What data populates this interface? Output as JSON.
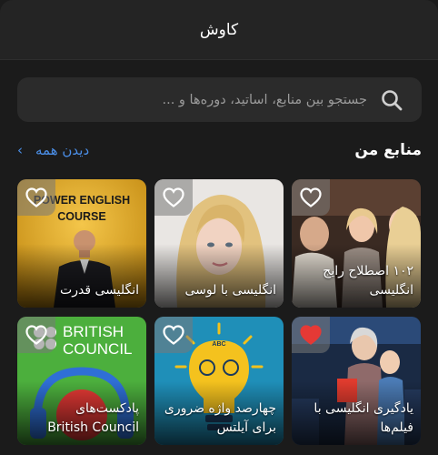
{
  "header": {
    "title": "کاوش"
  },
  "search": {
    "placeholder": "جستجو بین منابع، اساتید، دوره‌ها و ..."
  },
  "section": {
    "title": "منابع من",
    "see_all": "دیدن همه",
    "chevron": "‹"
  },
  "cards": [
    {
      "line1": "انگلیسی قدرت",
      "line2": "",
      "favorited": false,
      "art_text": [
        "POWER ENGLISH",
        "COURSE"
      ]
    },
    {
      "line1": "انگلیسی با لوسی",
      "line2": "",
      "favorited": false
    },
    {
      "line1": "۱۰۲ اصطلاح رایج",
      "line2": "انگلیسی",
      "favorited": false
    },
    {
      "line1": "پادکست‌های",
      "line2": "British Council",
      "favorited": false,
      "art_text": [
        "BRITISH",
        "COUNCIL"
      ]
    },
    {
      "line1": "چهارصد واژه ضروری",
      "line2": "برای آیلتس",
      "favorited": false,
      "art_text": [
        "ABC"
      ]
    },
    {
      "line1": "یادگیری انگلیسی با",
      "line2": "فیلم‌ها",
      "favorited": true
    }
  ],
  "colors": {
    "accent": "#4b8fe8",
    "heart_active": "#e53935",
    "background": "#1b1b1b"
  }
}
